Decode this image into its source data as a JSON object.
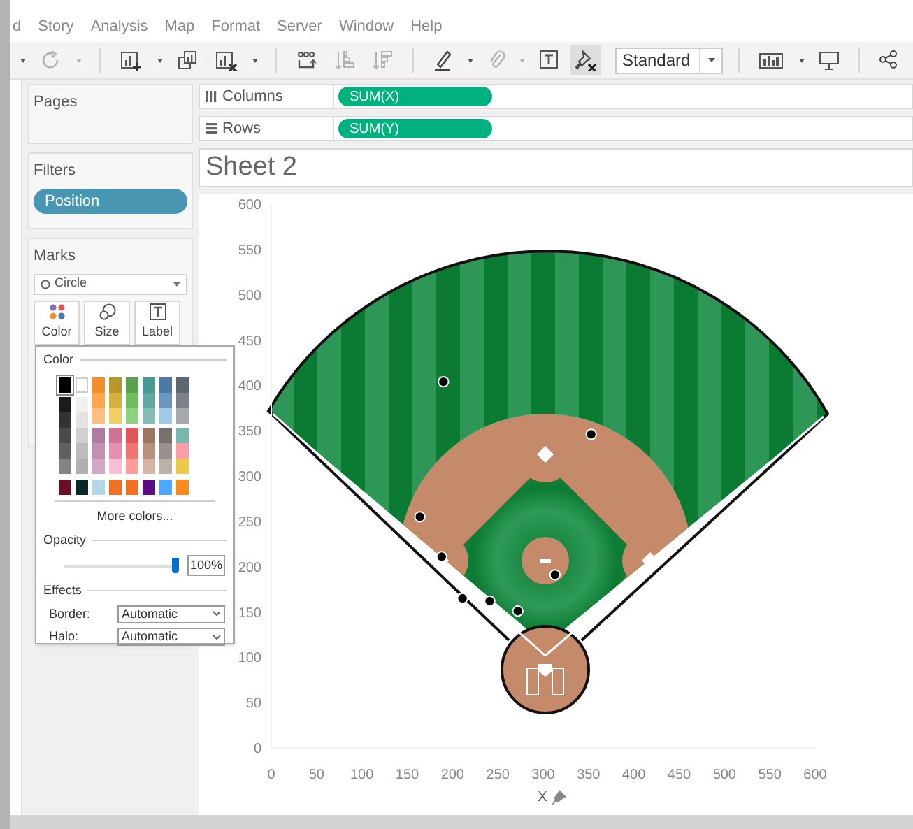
{
  "menu": [
    "d",
    "Story",
    "Analysis",
    "Map",
    "Format",
    "Server",
    "Window",
    "Help"
  ],
  "toolbar": {
    "items": [
      {
        "kind": "caret",
        "disabled": false
      },
      {
        "kind": "refresh",
        "disabled": true
      },
      {
        "kind": "caret",
        "disabled": true
      },
      {
        "kind": "sep"
      },
      {
        "kind": "new-sheet",
        "disabled": false
      },
      {
        "kind": "caret",
        "disabled": false
      },
      {
        "kind": "duplicate",
        "disabled": false
      },
      {
        "kind": "clear-sheet",
        "disabled": false
      },
      {
        "kind": "caret",
        "disabled": false
      },
      {
        "kind": "sep"
      },
      {
        "kind": "swap",
        "disabled": false
      },
      {
        "kind": "sort-asc",
        "disabled": true
      },
      {
        "kind": "sort-desc",
        "disabled": true
      },
      {
        "kind": "sep"
      },
      {
        "kind": "highlight",
        "disabled": false
      },
      {
        "kind": "caret",
        "disabled": false
      },
      {
        "kind": "clip",
        "disabled": true
      },
      {
        "kind": "caret",
        "disabled": true
      },
      {
        "kind": "text",
        "disabled": false
      },
      {
        "kind": "pin",
        "disabled": false,
        "pressed": true
      }
    ],
    "fit": "Standard",
    "items_after": [
      {
        "kind": "sep"
      },
      {
        "kind": "show-me",
        "disabled": false
      },
      {
        "kind": "caret",
        "disabled": false
      },
      {
        "kind": "present",
        "disabled": false
      },
      {
        "kind": "sep"
      },
      {
        "kind": "share",
        "disabled": false
      }
    ]
  },
  "pages": {
    "title": "Pages"
  },
  "filters": {
    "title": "Filters",
    "pills": [
      "Position"
    ]
  },
  "marks": {
    "title": "Marks",
    "mark_type": "Circle",
    "buttons": [
      {
        "kind": "color",
        "label": "Color"
      },
      {
        "kind": "size",
        "label": "Size"
      },
      {
        "kind": "label",
        "label": "Label"
      }
    ]
  },
  "shelves": [
    {
      "kind": "columns",
      "label": "Columns",
      "pills": [
        "SUM(X)"
      ]
    },
    {
      "kind": "rows",
      "label": "Rows",
      "pills": [
        "SUM(Y)"
      ]
    }
  ],
  "sheet_title": "Sheet 2",
  "chart_data": {
    "type": "scatter",
    "xlabel": "X",
    "x": [
      164,
      188,
      190,
      211,
      241,
      272,
      313,
      353
    ],
    "series": [
      {
        "color": "#000000",
        "values": [
          255,
          211,
          404,
          165,
          162,
          151,
          191,
          346
        ]
      }
    ],
    "xlim": [
      0,
      600
    ],
    "ylim": [
      0,
      600
    ],
    "xticks": [
      0,
      50,
      100,
      150,
      200,
      250,
      300,
      350,
      400,
      450,
      500,
      550,
      600
    ],
    "yticks": [
      0,
      50,
      100,
      150,
      200,
      250,
      300,
      350,
      400,
      450,
      500,
      550,
      600
    ]
  },
  "color_popup": {
    "title": "Color",
    "top": [
      {
        "color": "#000000",
        "selected": true
      },
      {
        "color": "#ffffff",
        "selected": false
      }
    ],
    "gray_columns": [
      [
        {
          "color": "#1b1b1b"
        },
        {
          "color": "#333333"
        },
        {
          "color": "#4a4a4a"
        },
        {
          "color": "#606060"
        },
        {
          "color": "#838383"
        }
      ],
      [
        {
          "color": "#f0f0f0"
        },
        {
          "color": "#e3e3e3"
        },
        {
          "color": "#d0d0d0"
        },
        {
          "color": "#bdbdbd"
        },
        {
          "color": "#b0b0b0"
        }
      ]
    ],
    "hue_blocks": [
      [
        [
          {
            "color": "#f28e2b"
          },
          {
            "color": "#ffa64d"
          },
          {
            "color": "#ffbe7d"
          }
        ],
        [
          {
            "color": "#b8962e"
          },
          {
            "color": "#d4b23c"
          },
          {
            "color": "#f1ce63"
          }
        ],
        [
          {
            "color": "#59a14f"
          },
          {
            "color": "#6fbf5f"
          },
          {
            "color": "#8cd17d"
          }
        ],
        [
          {
            "color": "#499894"
          },
          {
            "color": "#5fa8a2"
          },
          {
            "color": "#86bcb6"
          }
        ],
        [
          {
            "color": "#4e79a7"
          },
          {
            "color": "#6d95c2"
          },
          {
            "color": "#a0cbe8"
          }
        ],
        [
          {
            "color": "#5e6670"
          },
          {
            "color": "#7b828c"
          },
          {
            "color": "#a5a9ab"
          }
        ]
      ],
      [
        [
          {
            "color": "#b07aa1"
          },
          {
            "color": "#c48fb5"
          },
          {
            "color": "#d4a6c8"
          }
        ],
        [
          {
            "color": "#d37295"
          },
          {
            "color": "#e690b0"
          },
          {
            "color": "#fabfd2"
          }
        ],
        [
          {
            "color": "#e15759"
          },
          {
            "color": "#ef7575"
          },
          {
            "color": "#ff9d9a"
          }
        ],
        [
          {
            "color": "#9d7660"
          },
          {
            "color": "#b8927f"
          },
          {
            "color": "#d7b5a6"
          }
        ],
        [
          {
            "color": "#79706e"
          },
          {
            "color": "#9a918f"
          },
          {
            "color": "#bab0ac"
          }
        ],
        [
          {
            "color": "#76b7b2"
          },
          {
            "color": "#ff9da7"
          },
          {
            "color": "#edc948"
          }
        ]
      ]
    ],
    "recent": [
      {
        "color": "#6a0f22"
      },
      {
        "color": "#062a2a"
      },
      {
        "color": "#b3d6e8"
      },
      {
        "color": "#f07125"
      },
      {
        "color": "#f07125"
      },
      {
        "color": "#5b0e86"
      },
      {
        "color": "#4da6ff"
      },
      {
        "color": "#ff8c1a"
      }
    ],
    "more_colors": "More colors...",
    "opacity_title": "Opacity",
    "opacity": {
      "level": 1.0
    },
    "opacity_value": "100%",
    "effects_title": "Effects",
    "effects": [
      {
        "label": "Border:",
        "value": "Automatic"
      },
      {
        "label": "Halo:",
        "value": "Automatic"
      }
    ]
  }
}
